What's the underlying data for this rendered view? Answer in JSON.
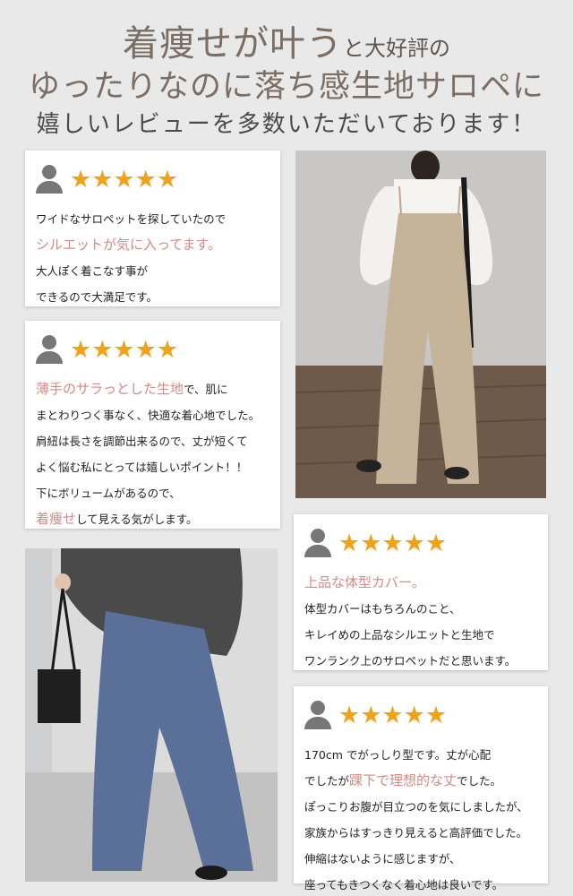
{
  "header": {
    "line1_big": "着痩せが叶う",
    "line1_small": "と大好評の",
    "line2": "ゆったりなのに落ち感生地サロペに",
    "line3": "嬉しいレビューを多数いただいております！"
  },
  "reviews": [
    {
      "stars": "★★★★★",
      "line1": "ワイドなサロペットを探していたので",
      "line2_highlight": "シルエットが気に入ってます。",
      "line3": "大人ぽく着こなす事が",
      "line4": "できるので大満足です。"
    },
    {
      "stars": "★★★★★",
      "line1_highlight": "薄手のサラっとした生地",
      "line1_rest": "で、肌に",
      "line2": "まとわりつく事なく、快適な着心地でした。",
      "line3": "肩紐は長さを調節出来るので、丈が短くて",
      "line4": "よく悩む私にとっては嬉しいポイント！！",
      "line5": "下にボリュームがあるので、",
      "line6_highlight": "着痩せ",
      "line6_rest": "して見える気がします。"
    },
    {
      "stars": "★★★★★",
      "line1_highlight": "上品な体型カバー。",
      "line2": "体型カバーはもちろんのこと、",
      "line3": "キレイめの上品なシルエットと生地で",
      "line4": "ワンランク上のサロペットだと思います。"
    },
    {
      "stars": "★★★★★",
      "line1": "170cm でがっしり型です。丈が心配",
      "line2_start": "でしたが",
      "line2_highlight": "踝下で理想的な丈",
      "line2_end": "でした。",
      "line3": "ぽっこりお腹が目立つのを気にしましたが、",
      "line4": "家族からはすっきり見えると高評価でした。",
      "line5": "伸縮はないように感じますが、",
      "line6": "座ってもきつくなく着心地は良いです。"
    }
  ],
  "colors": {
    "background": "#e9e9ea",
    "star": "#f2a21a",
    "highlight": "#d48a86",
    "title": "#7a6e65"
  }
}
